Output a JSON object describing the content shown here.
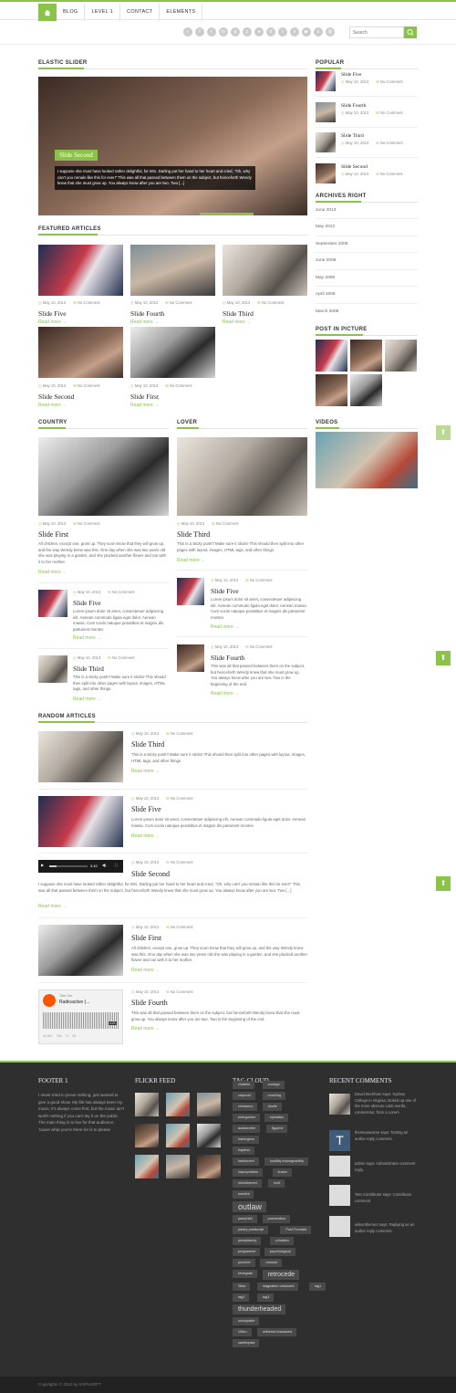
{
  "nav": {
    "items": [
      "BLOG",
      "LEVEL 1",
      "CONTACT",
      "ELEMENTS"
    ]
  },
  "search": {
    "placeholder": "Search"
  },
  "colors": {
    "accent": "#8bc34a",
    "footer_bg": "#2f2f2f"
  },
  "slider": {
    "heading": "ELASTIC SLIDER",
    "title": "Slide Second",
    "text": "I suppose she must have looked rather delightful, for Mrs. Darling put her hand to her heart and cried, \"Oh, why can't you remain like this for ever!\" This was all that passed between them on the subject, but henceforth Wendy knew that she must grow up. You always know after you are two. Two [...]"
  },
  "featured": {
    "heading": "FEATURED ARTICLES",
    "posts": [
      {
        "title": "Slide Five",
        "date": "May 10, 2013",
        "comments": "No Comment",
        "more": "Read more →"
      },
      {
        "title": "Slide Fourth",
        "date": "May 10, 2013",
        "comments": "No Comment",
        "more": "Read more →"
      },
      {
        "title": "Slide Third",
        "date": "May 10, 2013",
        "comments": "No Comment",
        "more": "Read more →"
      },
      {
        "title": "Slide Second",
        "date": "May 10, 2013",
        "comments": "No Comment",
        "more": "Read more →"
      },
      {
        "title": "Slide First",
        "date": "May 10, 2013",
        "comments": "No Comment",
        "more": "Read more →"
      }
    ]
  },
  "country": {
    "heading": "COUNTRY",
    "main": {
      "title": "Slide First",
      "date": "May 10, 2013",
      "comments": "No Comment",
      "text": "All children, except one, grow up. They soon know that they will grow up, and the way Wendy knew was this. One day when she was two years old she was playing in a garden, and she plucked another flower and ran with it to her mother.",
      "more": "Read more →"
    },
    "list": [
      {
        "title": "Slide Five",
        "date": "May 10, 2013",
        "comments": "No Comment",
        "text": "Lorem ipsum dolor sit amet, consectetuer adipiscing elit. Aenean commodo ligula eget dolor. Aenean massa. Cum sociis natoque penatibus et magnis dis parturient montes",
        "more": "Read more →"
      },
      {
        "title": "Slide Third",
        "date": "May 10, 2013",
        "comments": "No Comment",
        "text": "This is a sticky post!!! Make sure it sticks! This should then split into other pages with layout, images, HTML tags, and other things.",
        "more": "Read more →"
      }
    ]
  },
  "lover": {
    "heading": "LOVER",
    "main": {
      "title": "Slide Third",
      "date": "May 10, 2013",
      "comments": "No Comment",
      "text": "This is a sticky post!!! Make sure it sticks! This should then split into other pages with layout, images, HTML tags, and other things.",
      "more": "Read more →"
    },
    "list": [
      {
        "title": "Slide Five",
        "date": "May 10, 2013",
        "comments": "No Comment",
        "text": "Lorem ipsum dolor sit amet, consectetuer adipiscing elit. Aenean commodo ligula eget dolor. Aenean massa. Cum sociis natoque penatibus et magnis dis parturient montes",
        "more": "Read more →"
      },
      {
        "title": "Slide Fourth",
        "date": "May 10, 2013",
        "comments": "No Comment",
        "text": "This was all that passed between them on the subject, but henceforth Wendy knew that she must grow up. You always know after you are two. Two is the beginning of the end.",
        "more": "Read more →"
      }
    ]
  },
  "random": {
    "heading": "RANDOM ARTICLES",
    "posts": [
      {
        "title": "Slide Third",
        "date": "May 10, 2013",
        "comments": "No Comment",
        "text": "This is a sticky post!!! Make sure it sticks! This should then split into other pages with layout, images, HTML tags, and other things.",
        "more": "Read more →"
      },
      {
        "title": "Slide Five",
        "date": "May 10, 2013",
        "comments": "No Comment",
        "text": "Lorem ipsum dolor sit amet, consectetuer adipiscing elit. Aenean commodo ligula eget dolor. Aenean massa. Cum sociis natoque penatibus et magnis dis parturient montes",
        "more": "Read more →"
      },
      {
        "title": "Slide Second",
        "date": "May 10, 2013",
        "comments": "No Comment",
        "text": "I suppose she must have looked rather delightful, for Mrs. Darling put her hand to her heart and cried, \"Oh, why can't you remain like this for ever!\" This was all that passed between them on the subject, but henceforth Wendy knew that she must grow up. You always know after you are two. Two [...]",
        "more": "Read more →"
      },
      {
        "title": "Slide First",
        "date": "May 10, 2013",
        "comments": "No Comment",
        "text": "All children, except one, grow up. They soon know that they will grow up, and the way Wendy knew was this. One day when she was two years old she was playing in a garden, and she plucked another flower and ran with it to her mother.",
        "more": "Read more →"
      },
      {
        "title": "Slide Fourth",
        "date": "May 10, 2013",
        "comments": "No Comment",
        "text": "This was all that passed between them on the subject, but henceforth Wendy knew that she must grow up. You always know after you are two. Two is the beginning of the end.",
        "more": "Read more →"
      }
    ],
    "player_time": "3:10",
    "audio": {
      "artist": "Title Ore",
      "track": "Radioactive (...",
      "duration": "4:21",
      "plays": "42,907",
      "likes": "746",
      "reposts": "71",
      "comments": "52"
    }
  },
  "sidebar": {
    "popular": {
      "heading": "POPULAR",
      "posts": [
        {
          "title": "Slide Five",
          "date": "May 10, 2013",
          "comments": "No Comment"
        },
        {
          "title": "Slide Fourth",
          "date": "May 10, 2013",
          "comments": "No Comment"
        },
        {
          "title": "Slide Third",
          "date": "May 10, 2013",
          "comments": "No Comment"
        },
        {
          "title": "Slide Second",
          "date": "May 10, 2013",
          "comments": "No Comment"
        }
      ]
    },
    "archives": {
      "heading": "ARCHIVES RIGHT",
      "items": [
        "June 2013",
        "May 2013",
        "September 2008",
        "June 2008",
        "May 2008",
        "April 2008",
        "March 2008"
      ]
    },
    "pictures": {
      "heading": "POST IN PICTURE"
    },
    "videos": {
      "heading": "VIDEOS"
    }
  },
  "footer": {
    "about": {
      "heading": "FOOTER 1",
      "text": "I never tried to prove nothing, just wanted to give a good show. My life has always been my music, it's always come first, but the music ain't worth nothing if you can't lay it on the public. The main thing is to live for that audience, 'cause what you're there for is to please"
    },
    "flickr": {
      "heading": "FLICKR FEED"
    },
    "tags": {
      "heading": "TAG CLOUD",
      "items": [
        "chattels",
        "consign",
        "claycold",
        "crushing",
        "cinnamon",
        "doolie",
        "energumen",
        "ephialtes",
        "audiometer",
        "figurine",
        "habergeon",
        "hapless",
        "hatchment",
        "hostility impregnability",
        "impropriation",
        "knave",
        "misinformed",
        "moil",
        "montful",
        "outlaw",
        "pamphlet",
        "pneumatics",
        "pantry postscript",
        "Post Formats",
        "precipitancy",
        "privation",
        "programme",
        "psychological",
        "puncher",
        "ramose",
        "renegade",
        "retrocede",
        "Slide",
        "stagnation unhorsed",
        "tag1",
        "tag2",
        "tag3",
        "thunderheaded",
        "unculpable",
        "Video",
        "withered brandnew",
        "xanthopsia"
      ]
    },
    "comments": {
      "heading": "RECENT COMMENTS",
      "items": [
        {
          "text": "David Beckham says: Sydney College in Virginia, looked up one of the more obscure Latin words, consectetur, from a Lorem"
        },
        {
          "text": "themeawesme says: Testing an author reply comment."
        },
        {
          "text": "admin says: Administrator comment reply."
        },
        {
          "text": "Test Contributor says: Contributor comment"
        },
        {
          "text": "wilsontheme2 says: Replying as an author reply comment."
        }
      ]
    },
    "copyright": "Copyrights © 2013 by KOPASOFT"
  }
}
